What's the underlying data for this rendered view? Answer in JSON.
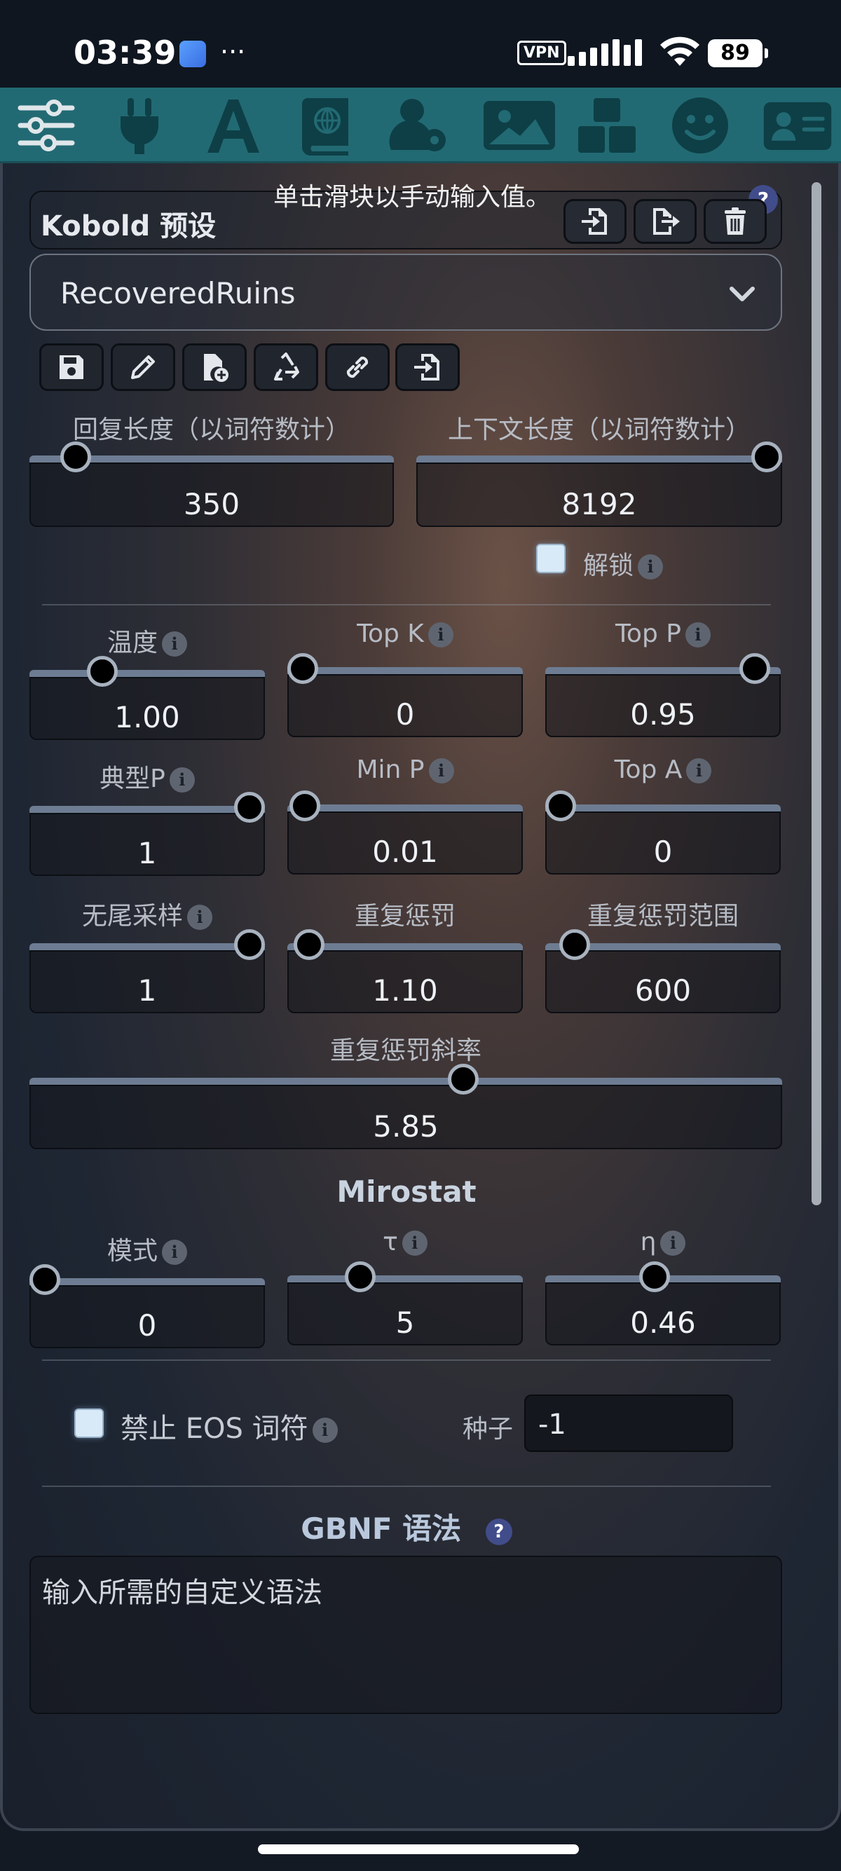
{
  "status_bar": {
    "time": "03:39",
    "dots": "···",
    "vpn": "VPN",
    "battery": "89"
  },
  "tabs": [
    {
      "icon": "sliders-icon"
    },
    {
      "icon": "plug-icon"
    },
    {
      "icon": "font-a-icon"
    },
    {
      "icon": "globe-book-icon"
    },
    {
      "icon": "user-gear-icon"
    },
    {
      "icon": "landscape-image-icon"
    },
    {
      "icon": "cubes-icon"
    },
    {
      "icon": "smiley-icon"
    },
    {
      "icon": "id-card-icon"
    }
  ],
  "preset": {
    "title": "Kobold 预设",
    "toast": "单击滑块以手动输入值。",
    "help": "?",
    "selected": "RecoveredRuins"
  },
  "sliders": {
    "response_length": {
      "label": "回复长度（以词符数计）",
      "value": "350",
      "level": 0.092
    },
    "context_length": {
      "label": "上下文长度（以词符数计）",
      "value": "8192",
      "level": 1.0
    },
    "temperature": {
      "label": "温度",
      "value": "1.00",
      "level": 0.28
    },
    "top_k": {
      "label": "Top K",
      "value": "0",
      "level": 0.0
    },
    "top_p": {
      "label": "Top P",
      "value": "0.95",
      "level": 0.95
    },
    "typical_p": {
      "label": "典型P",
      "value": "1",
      "level": 1.0
    },
    "min_p": {
      "label": "Min P",
      "value": "0.01",
      "level": 0.01
    },
    "top_a": {
      "label": "Top A",
      "value": "0",
      "level": 0.0
    },
    "tail_free": {
      "label": "无尾采样",
      "value": "1",
      "level": 1.0
    },
    "rep_pen": {
      "label": "重复惩罚",
      "value": "1.10",
      "level": 0.03
    },
    "rep_pen_range": {
      "label": "重复惩罚范围",
      "value": "600",
      "level": 0.07
    },
    "rep_pen_slope": {
      "label": "重复惩罚斜率",
      "value": "5.85",
      "level": 0.58
    },
    "mirostat_mode": {
      "label": "模式",
      "value": "0",
      "level": 0.0
    },
    "mirostat_tau": {
      "label": "τ",
      "value": "5",
      "level": 0.28
    },
    "mirostat_eta": {
      "label": "η",
      "value": "0.46",
      "level": 0.46
    }
  },
  "unlock_label": "解锁",
  "mirostat_title": "Mirostat",
  "ban_eos_label": "禁止 EOS 词符",
  "seed": {
    "label": "种子",
    "value": "-1"
  },
  "gbnf": {
    "title": "GBNF 语法",
    "help": "?",
    "placeholder": "输入所需的自定义语法"
  },
  "info_glyph": "i"
}
